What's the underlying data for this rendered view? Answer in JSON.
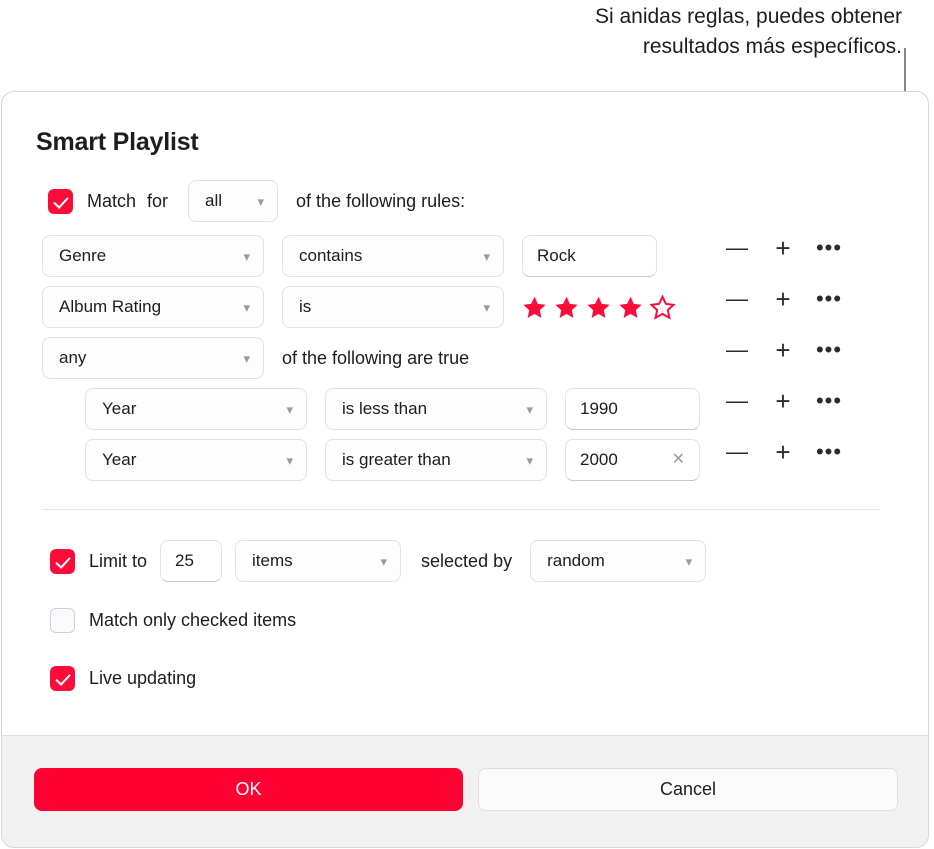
{
  "callout": {
    "text": "Si anidas reglas, puedes obtener\nresultados más específicos."
  },
  "dialog": {
    "title": "Smart Playlist",
    "match": {
      "checked": true,
      "label": "Match",
      "label_for": "for",
      "scope_value": "all",
      "tail_label": "of the following rules:"
    },
    "rules": [
      {
        "nesting": 0,
        "field": "Genre",
        "operator": "contains",
        "value_type": "text",
        "value": "Rock",
        "clearable": false
      },
      {
        "nesting": 0,
        "field": "Album Rating",
        "operator": "is",
        "value_type": "stars",
        "stars_filled": 4,
        "stars_total": 5
      },
      {
        "nesting": 0,
        "field": "any",
        "value_type": "group",
        "group_label": "of the following are true"
      },
      {
        "nesting": 1,
        "field": "Year",
        "operator": "is less than",
        "value_type": "text",
        "value": "1990",
        "clearable": false
      },
      {
        "nesting": 1,
        "field": "Year",
        "operator": "is greater than",
        "value_type": "text",
        "value": "2000",
        "clearable": true
      }
    ],
    "row_actions": {
      "remove": "—",
      "add": "+",
      "more": "•••"
    },
    "options": {
      "limit": {
        "checked": true,
        "label": "Limit to",
        "count": "25",
        "unit": "items",
        "selected_by_label": "selected by",
        "order": "random"
      },
      "match_only_checked": {
        "checked": false,
        "label": "Match only checked items"
      },
      "live_updating": {
        "checked": true,
        "label": "Live updating"
      }
    },
    "footer": {
      "ok_label": "OK",
      "cancel_label": "Cancel"
    }
  },
  "colors": {
    "accent_red": "#ff0033",
    "checkbox_red": "#ff0b39",
    "star_red": "#ff0b39",
    "footer_bg": "#f1f1f1"
  }
}
